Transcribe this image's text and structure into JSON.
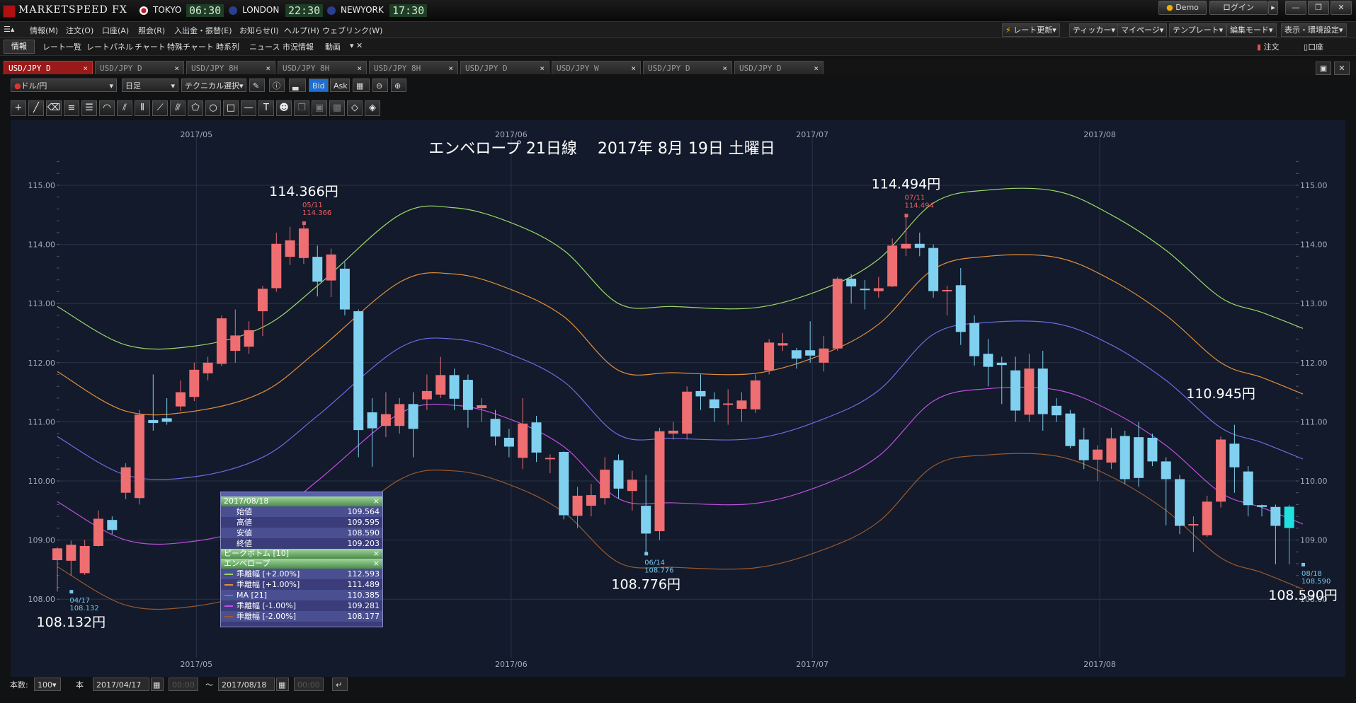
{
  "app": {
    "title": "MARKETSPEED FX",
    "clocks": [
      {
        "city": "TOKYO",
        "time": "06:30",
        "flag_color": "#c0192b"
      },
      {
        "city": "LONDON",
        "time": "22:30",
        "flag_color": "#2a3f8f"
      },
      {
        "city": "NEWYORK",
        "time": "17:30",
        "flag_color": "#2a3f8f"
      }
    ],
    "demo_label": "Demo",
    "login_label": "ログイン"
  },
  "menu": [
    "情報(M)",
    "注文(O)",
    "口座(A)",
    "照会(R)",
    "入出金・振替(E)",
    "お知らせ(I)",
    "ヘルプ(H)",
    "ウェブリンク(W)"
  ],
  "menu_right": [
    "レート更新",
    "ティッカー",
    "マイページ",
    "テンプレート",
    "編集モード",
    "表示・環境設定"
  ],
  "toolbar2": {
    "tab": "情報",
    "items": [
      "レート一覧",
      "レートパネル",
      "チャート",
      "特殊チャート",
      "時系列",
      "ニュース",
      "市況情報",
      "動画"
    ],
    "right": [
      "注文",
      "口座"
    ]
  },
  "tabs": [
    "USD/JPY D",
    "USD/JPY D",
    "USD/JPY 8H",
    "USD/JPY 8H",
    "USD/JPY 8H",
    "USD/JPY D",
    "USD/JPY W",
    "USD/JPY D",
    "USD/JPY D"
  ],
  "chart_toolbar": {
    "pair": "ドル/円",
    "period": "日足",
    "technical": "テクニカル選択",
    "bid": "Bid",
    "ask": "Ask"
  },
  "statusbar": {
    "count_label": "本数:",
    "count": "100",
    "unit": "本",
    "from": "2017/04/17",
    "to": "2017/08/18",
    "time_placeholder": "00:00",
    "sep": "～"
  },
  "info_popup": {
    "date": "2017/08/18",
    "ohlc": [
      {
        "k": "始値",
        "v": "109.564"
      },
      {
        "k": "高値",
        "v": "109.595"
      },
      {
        "k": "安値",
        "v": "108.590"
      },
      {
        "k": "終値",
        "v": "109.203"
      }
    ],
    "peak": "ピークボトム [10]",
    "env": "エンベロープ",
    "env_rows": [
      {
        "k": "乖離幅 [+2.00%]",
        "v": "112.593",
        "color": "#9cd86a"
      },
      {
        "k": "乖離幅 [+1.00%]",
        "v": "111.489",
        "color": "#e2903a"
      },
      {
        "k": "MA [21]",
        "v": "110.385",
        "color": "#6a6ee8"
      },
      {
        "k": "乖離幅 [-1.00%]",
        "v": "109.281",
        "color": "#c050e0"
      },
      {
        "k": "乖離幅 [-2.00%]",
        "v": "108.177",
        "color": "#9a5a30"
      }
    ]
  },
  "chart_data": {
    "type": "candlestick",
    "title": "エンベロープ 21日線　 2017年 8月 19日 土曜日",
    "ylim": [
      107.8,
      115.6
    ],
    "yticks": [
      "108.00",
      "109.00",
      "110.00",
      "111.00",
      "112.00",
      "113.00",
      "114.00",
      "115.00"
    ],
    "month_labels": [
      {
        "label": "2017/05",
        "idx": 10
      },
      {
        "label": "2017/06",
        "idx": 33
      },
      {
        "label": "2017/07",
        "idx": 55
      },
      {
        "label": "2017/08",
        "idx": 76
      }
    ],
    "annotations": [
      {
        "text": "114.366円",
        "idx": 18,
        "y": 114.366,
        "pos": "above"
      },
      {
        "text": "108.132円",
        "idx": 1,
        "y": 108.132,
        "pos": "below"
      },
      {
        "text": "108.776円",
        "idx": 43,
        "y": 108.776,
        "pos": "below"
      },
      {
        "text": "114.494円",
        "idx": 62,
        "y": 114.494,
        "pos": "above"
      },
      {
        "text": "110.945円",
        "idx": 85,
        "y": 110.945,
        "pos": "above"
      },
      {
        "text": "108.590円",
        "idx": 91,
        "y": 108.59,
        "pos": "below"
      }
    ],
    "small_labels": [
      {
        "date": "05/11",
        "value": "114.366",
        "idx": 18,
        "y": 114.366,
        "color": "#e86060",
        "pos": "above"
      },
      {
        "date": "04/17",
        "value": "108.132",
        "idx": 1,
        "y": 108.132,
        "color": "#7ac6ec",
        "pos": "below"
      },
      {
        "date": "06/14",
        "value": "108.776",
        "idx": 43,
        "y": 108.776,
        "color": "#7ac6ec",
        "pos": "below"
      },
      {
        "date": "07/11",
        "value": "114.494",
        "idx": 62,
        "y": 114.494,
        "color": "#e86060",
        "pos": "above"
      },
      {
        "date": "08/18",
        "value": "108.590",
        "idx": 91,
        "y": 108.59,
        "color": "#7ac6ec",
        "pos": "below"
      }
    ],
    "candles": [
      [
        108.66,
        108.86,
        108.13,
        108.88
      ],
      [
        108.65,
        108.92,
        108.4,
        108.99
      ],
      [
        108.44,
        108.9,
        108.41,
        109.0
      ],
      [
        108.9,
        109.36,
        108.89,
        109.5
      ],
      [
        109.34,
        109.17,
        109.1,
        109.4
      ],
      [
        109.8,
        110.23,
        109.69,
        110.3
      ],
      [
        109.71,
        111.12,
        109.6,
        111.2
      ],
      [
        111.03,
        110.98,
        110.85,
        111.8
      ],
      [
        111.06,
        111.0,
        110.95,
        111.4
      ],
      [
        111.26,
        111.5,
        111.18,
        111.7
      ],
      [
        111.42,
        111.88,
        111.35,
        112.0
      ],
      [
        111.82,
        112.0,
        111.7,
        112.1
      ],
      [
        111.98,
        112.75,
        111.94,
        112.8
      ],
      [
        112.2,
        112.46,
        112.0,
        112.9
      ],
      [
        112.27,
        112.55,
        112.15,
        112.7
      ],
      [
        112.87,
        113.25,
        112.45,
        113.3
      ],
      [
        113.26,
        114.01,
        113.2,
        114.2
      ],
      [
        113.79,
        114.07,
        113.65,
        114.3
      ],
      [
        113.77,
        114.27,
        113.67,
        114.37
      ],
      [
        113.79,
        113.37,
        113.12,
        113.98
      ],
      [
        113.39,
        113.83,
        113.11,
        113.93
      ],
      [
        113.59,
        112.9,
        112.8,
        113.7
      ],
      [
        112.87,
        110.86,
        110.4,
        112.9
      ],
      [
        111.16,
        110.89,
        110.24,
        111.4
      ],
      [
        110.93,
        111.13,
        110.74,
        111.5
      ],
      [
        110.93,
        111.3,
        110.8,
        111.4
      ],
      [
        111.3,
        110.88,
        110.4,
        111.5
      ],
      [
        111.38,
        111.52,
        111.2,
        111.8
      ],
      [
        111.46,
        111.79,
        111.4,
        112.1
      ],
      [
        111.79,
        111.39,
        111.2,
        111.9
      ],
      [
        111.71,
        111.2,
        110.9,
        111.8
      ],
      [
        111.23,
        111.28,
        111.0,
        111.4
      ],
      [
        111.05,
        110.75,
        110.6,
        111.2
      ],
      [
        110.73,
        110.58,
        110.4,
        110.88
      ],
      [
        110.39,
        110.97,
        110.2,
        111.4
      ],
      [
        110.99,
        110.48,
        110.32,
        111.1
      ],
      [
        110.37,
        110.39,
        110.13,
        110.45
      ],
      [
        110.49,
        109.42,
        109.35,
        110.5
      ],
      [
        109.41,
        109.75,
        109.2,
        109.9
      ],
      [
        109.58,
        109.76,
        109.4,
        109.95
      ],
      [
        109.71,
        110.19,
        109.6,
        110.4
      ],
      [
        110.35,
        109.87,
        109.7,
        110.45
      ],
      [
        109.83,
        110.02,
        109.5,
        110.17
      ],
      [
        109.58,
        109.11,
        108.77,
        110.1
      ],
      [
        109.15,
        110.84,
        109.0,
        110.9
      ],
      [
        110.8,
        110.85,
        110.7,
        111.0
      ],
      [
        110.8,
        111.51,
        110.7,
        111.6
      ],
      [
        111.52,
        111.43,
        111.2,
        111.8
      ],
      [
        111.38,
        111.23,
        111.0,
        111.5
      ],
      [
        111.29,
        111.31,
        110.95,
        111.55
      ],
      [
        111.22,
        111.36,
        111.0,
        111.5
      ],
      [
        111.21,
        111.7,
        111.15,
        111.8
      ],
      [
        111.87,
        112.34,
        111.8,
        112.4
      ],
      [
        112.29,
        112.33,
        112.2,
        112.5
      ],
      [
        112.21,
        112.07,
        111.9,
        112.25
      ],
      [
        112.21,
        112.12,
        112.0,
        112.7
      ],
      [
        112.0,
        112.24,
        111.85,
        112.45
      ],
      [
        112.24,
        113.42,
        112.2,
        113.45
      ],
      [
        113.42,
        113.29,
        113.0,
        113.5
      ],
      [
        113.25,
        113.24,
        112.9,
        113.4
      ],
      [
        113.21,
        113.26,
        113.1,
        113.45
      ],
      [
        113.29,
        113.98,
        113.28,
        114.1
      ],
      [
        113.93,
        114.01,
        113.8,
        114.49
      ],
      [
        114.01,
        113.94,
        113.8,
        114.2
      ],
      [
        113.94,
        113.21,
        113.1,
        114.0
      ],
      [
        113.23,
        113.23,
        112.8,
        113.3
      ],
      [
        113.31,
        112.52,
        112.3,
        113.6
      ],
      [
        112.67,
        112.11,
        111.95,
        112.8
      ],
      [
        112.15,
        111.93,
        111.6,
        112.4
      ],
      [
        112.0,
        111.96,
        111.3,
        112.1
      ],
      [
        111.87,
        111.19,
        111.0,
        112.1
      ],
      [
        111.12,
        111.9,
        111.0,
        112.15
      ],
      [
        111.9,
        111.13,
        110.85,
        112.2
      ],
      [
        111.27,
        111.11,
        111.0,
        111.4
      ],
      [
        111.14,
        110.59,
        110.55,
        111.2
      ],
      [
        110.7,
        110.35,
        110.2,
        110.9
      ],
      [
        110.36,
        110.53,
        110.0,
        110.6
      ],
      [
        110.31,
        110.72,
        110.2,
        110.9
      ],
      [
        110.76,
        110.03,
        109.95,
        110.85
      ],
      [
        110.74,
        110.05,
        109.9,
        111.0
      ],
      [
        110.73,
        110.33,
        110.25,
        110.8
      ],
      [
        110.33,
        110.03,
        109.25,
        110.4
      ],
      [
        110.03,
        109.24,
        109.1,
        110.1
      ],
      [
        109.26,
        109.27,
        108.8,
        109.4
      ],
      [
        109.08,
        109.65,
        109.05,
        109.75
      ],
      [
        109.65,
        110.7,
        109.55,
        110.75
      ],
      [
        110.63,
        110.23,
        109.8,
        110.95
      ],
      [
        110.16,
        109.59,
        109.4,
        110.25
      ],
      [
        109.59,
        109.56,
        109.4,
        109.6
      ],
      [
        109.56,
        109.24,
        108.59,
        109.6
      ],
      [
        109.564,
        109.203,
        108.59,
        109.595
      ]
    ],
    "series": [
      {
        "name": "乖離幅 [+2.00%]",
        "color": "#9cd86a",
        "keys": [
          [
            0,
            112.95
          ],
          [
            5,
            112.3
          ],
          [
            10,
            112.28
          ],
          [
            15,
            112.6
          ],
          [
            19,
            113.3
          ],
          [
            25,
            114.5
          ],
          [
            29,
            114.62
          ],
          [
            33,
            114.38
          ],
          [
            37,
            113.9
          ],
          [
            41,
            113.0
          ],
          [
            45,
            112.95
          ],
          [
            51,
            112.93
          ],
          [
            56,
            113.25
          ],
          [
            60,
            113.75
          ],
          [
            64,
            114.7
          ],
          [
            68,
            114.92
          ],
          [
            73,
            114.9
          ],
          [
            77,
            114.5
          ],
          [
            81,
            113.9
          ],
          [
            85,
            113.1
          ],
          [
            88,
            112.85
          ],
          [
            91,
            112.58
          ]
        ]
      },
      {
        "name": "乖離幅 [+1.00%]",
        "color": "#e2903a",
        "keys": [
          [
            0,
            111.85
          ],
          [
            5,
            111.18
          ],
          [
            10,
            111.18
          ],
          [
            15,
            111.5
          ],
          [
            19,
            112.2
          ],
          [
            25,
            113.36
          ],
          [
            29,
            113.5
          ],
          [
            33,
            113.25
          ],
          [
            37,
            112.78
          ],
          [
            41,
            111.87
          ],
          [
            45,
            111.83
          ],
          [
            51,
            111.82
          ],
          [
            56,
            112.15
          ],
          [
            60,
            112.65
          ],
          [
            64,
            113.58
          ],
          [
            68,
            113.8
          ],
          [
            73,
            113.78
          ],
          [
            77,
            113.4
          ],
          [
            81,
            112.8
          ],
          [
            85,
            112.0
          ],
          [
            88,
            111.75
          ],
          [
            91,
            111.47
          ]
        ]
      },
      {
        "name": "MA [21]",
        "color": "#6a6ee8",
        "keys": [
          [
            0,
            110.75
          ],
          [
            5,
            110.1
          ],
          [
            10,
            110.07
          ],
          [
            15,
            110.4
          ],
          [
            19,
            111.1
          ],
          [
            25,
            112.25
          ],
          [
            29,
            112.4
          ],
          [
            33,
            112.15
          ],
          [
            37,
            111.68
          ],
          [
            41,
            110.78
          ],
          [
            45,
            110.72
          ],
          [
            51,
            110.72
          ],
          [
            56,
            111.05
          ],
          [
            60,
            111.53
          ],
          [
            64,
            112.48
          ],
          [
            68,
            112.68
          ],
          [
            73,
            112.66
          ],
          [
            77,
            112.3
          ],
          [
            81,
            111.7
          ],
          [
            85,
            110.9
          ],
          [
            88,
            110.65
          ],
          [
            91,
            110.37
          ]
        ]
      },
      {
        "name": "乖離幅 [-1.00%]",
        "color": "#c050e0",
        "keys": [
          [
            0,
            109.65
          ],
          [
            5,
            109.0
          ],
          [
            10,
            108.98
          ],
          [
            15,
            109.3
          ],
          [
            19,
            110.0
          ],
          [
            25,
            111.14
          ],
          [
            29,
            111.28
          ],
          [
            33,
            111.05
          ],
          [
            37,
            110.58
          ],
          [
            41,
            109.7
          ],
          [
            45,
            109.63
          ],
          [
            51,
            109.62
          ],
          [
            56,
            109.94
          ],
          [
            60,
            110.42
          ],
          [
            64,
            111.35
          ],
          [
            68,
            111.56
          ],
          [
            73,
            111.54
          ],
          [
            77,
            111.18
          ],
          [
            81,
            110.6
          ],
          [
            85,
            109.8
          ],
          [
            88,
            109.55
          ],
          [
            91,
            109.27
          ]
        ]
      },
      {
        "name": "乖離幅 [-2.00%]",
        "color": "#9a5a30",
        "keys": [
          [
            0,
            108.55
          ],
          [
            5,
            107.9
          ],
          [
            10,
            107.88
          ],
          [
            15,
            108.2
          ],
          [
            19,
            108.9
          ],
          [
            25,
            110.02
          ],
          [
            29,
            110.17
          ],
          [
            33,
            109.94
          ],
          [
            37,
            109.47
          ],
          [
            41,
            108.62
          ],
          [
            45,
            108.54
          ],
          [
            51,
            108.53
          ],
          [
            56,
            108.84
          ],
          [
            60,
            109.31
          ],
          [
            64,
            110.25
          ],
          [
            68,
            110.44
          ],
          [
            73,
            110.42
          ],
          [
            77,
            110.07
          ],
          [
            81,
            109.5
          ],
          [
            85,
            108.7
          ],
          [
            88,
            108.45
          ],
          [
            91,
            108.17
          ]
        ]
      }
    ]
  }
}
